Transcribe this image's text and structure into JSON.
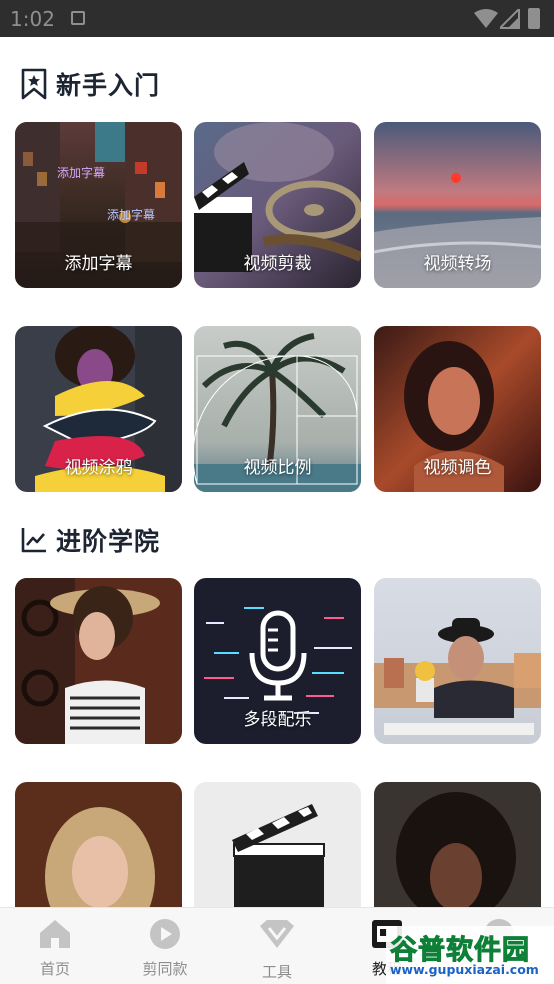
{
  "status_bar": {
    "time": "1:02"
  },
  "sections": {
    "beginner": {
      "title": "新手入门",
      "icon": "bookmark-star-icon"
    },
    "advanced": {
      "title": "进阶学院",
      "icon": "trend-chart-icon"
    }
  },
  "beginner_cards": [
    {
      "label": "添加字幕",
      "overlay_a": "添加字幕",
      "overlay_b": "添加字幕"
    },
    {
      "label": "视频剪裁"
    },
    {
      "label": "视频转场"
    },
    {
      "label": "视频涂鸦"
    },
    {
      "label": "视频比例"
    },
    {
      "label": "视频调色"
    }
  ],
  "advanced_cards": [
    {
      "label": ""
    },
    {
      "label": "多段配乐"
    },
    {
      "label": ""
    },
    {
      "label": ""
    },
    {
      "label": ""
    },
    {
      "label": ""
    }
  ],
  "tabbar": {
    "tabs": [
      {
        "label": "首页",
        "icon": "home-icon"
      },
      {
        "label": "剪同款",
        "icon": "play-circle-icon"
      },
      {
        "label": "工具",
        "icon": "diamond-icon"
      },
      {
        "label": "教程",
        "icon": "tutorial-icon",
        "active": true
      },
      {
        "label": "",
        "icon": "profile-icon"
      }
    ]
  },
  "watermark": {
    "text": "谷普软件园",
    "url": "www.gupuxiazai.com"
  }
}
